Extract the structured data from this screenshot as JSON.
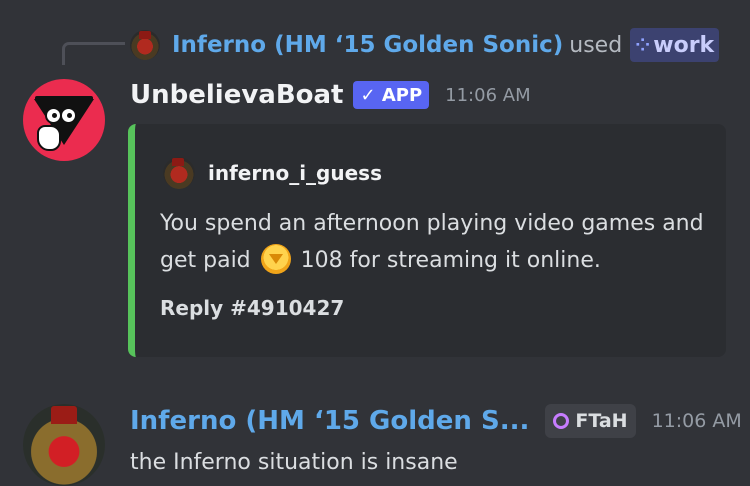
{
  "reply_reference": {
    "user_name": "Inferno (HM ‘15 Golden Sonic)",
    "action_text": "used",
    "command_icon": "command-icon",
    "command_name": "work"
  },
  "bot_message": {
    "author": "UnbelievaBoat",
    "badge": "✓ APP",
    "timestamp": "11:06 AM",
    "embed": {
      "accent_color": "#57c35b",
      "author_name": "inferno_i_guess",
      "description_part1": "You spend an afternoon playing video games and get paid",
      "amount": "108",
      "description_part2": "for streaming it online.",
      "currency_icon": "coin-icon",
      "footer": "Reply #4910427"
    }
  },
  "user_message": {
    "author": "Inferno (HM ‘15 Golden S...",
    "tag": "FTaH",
    "timestamp": "11:06 AM",
    "text": "the Inferno situation is insane"
  },
  "colors": {
    "background": "#313338",
    "name_blue": "#5fa9ea",
    "app_badge": "#5865f2",
    "embed_bg": "#2b2d31"
  }
}
